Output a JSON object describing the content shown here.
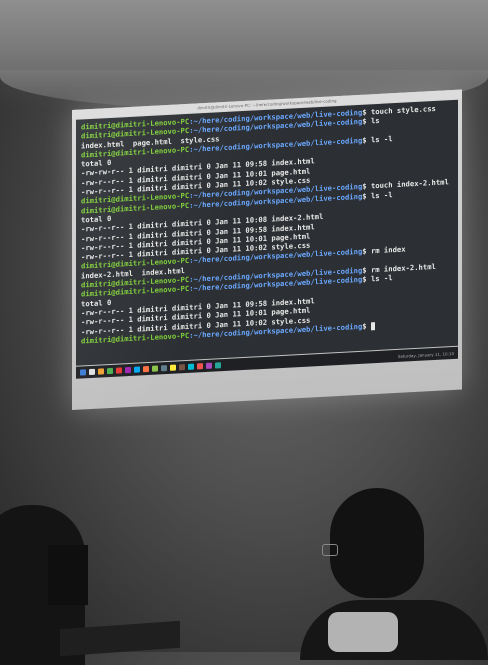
{
  "window": {
    "title": "dimitri@dimitri-Lenovo-PC: ~/here/coding/workspace/web/live-coding"
  },
  "prompt": {
    "user": "dimitri@dimitri-Lenovo-PC",
    "path": ":~/here/coding/workspace/web/live-coding",
    "symbol": "$ "
  },
  "lines": [
    {
      "type": "cmd",
      "cmd": "touch style.css"
    },
    {
      "type": "cmd",
      "cmd": "ls"
    },
    {
      "type": "out",
      "text": "index.html  page.html  style.css"
    },
    {
      "type": "cmd",
      "cmd": "ls -l"
    },
    {
      "type": "out",
      "text": "total 0"
    },
    {
      "type": "out",
      "text": "-rw-rw-r-- 1 dimitri dimitri 0 Jan 11 09:58 index.html"
    },
    {
      "type": "out",
      "text": "-rw-r--r-- 1 dimitri dimitri 0 Jan 11 10:01 page.html"
    },
    {
      "type": "out",
      "text": "-rw-r--r-- 1 dimitri dimitri 0 Jan 11 10:02 style.css"
    },
    {
      "type": "cmd",
      "cmd": "touch index-2.html"
    },
    {
      "type": "cmd",
      "cmd": "ls -l"
    },
    {
      "type": "out",
      "text": "total 0"
    },
    {
      "type": "out",
      "text": "-rw-r--r-- 1 dimitri dimitri 0 Jan 11 10:08 index-2.html"
    },
    {
      "type": "out",
      "text": "-rw-r--r-- 1 dimitri dimitri 0 Jan 11 09:58 index.html"
    },
    {
      "type": "out",
      "text": "-rw-r--r-- 1 dimitri dimitri 0 Jan 11 10:01 page.html"
    },
    {
      "type": "out",
      "text": "-rw-r--r-- 1 dimitri dimitri 0 Jan 11 10:02 style.css"
    },
    {
      "type": "cmd",
      "cmd": "rm index"
    },
    {
      "type": "out",
      "text": "index-2.html  index.html"
    },
    {
      "type": "cmd",
      "cmd": "rm index-2.html"
    },
    {
      "type": "cmd",
      "cmd": "ls -l"
    },
    {
      "type": "out",
      "text": "total 0"
    },
    {
      "type": "out",
      "text": "-rw-r--r-- 1 dimitri dimitri 0 Jan 11 09:58 index.html"
    },
    {
      "type": "out",
      "text": "-rw-r--r-- 1 dimitri dimitri 0 Jan 11 10:01 page.html"
    },
    {
      "type": "out",
      "text": "-rw-r--r-- 1 dimitri dimitri 0 Jan 11 10:02 style.css"
    },
    {
      "type": "cmd",
      "cmd": "",
      "cursor": true
    }
  ],
  "taskbar": {
    "icons": [
      "#3a7bd5",
      "#e0e0e0",
      "#f0a030",
      "#4caf50",
      "#e53935",
      "#9c27b0",
      "#03a9f4",
      "#ff7043",
      "#8bc34a",
      "#607d8b",
      "#ffeb3b",
      "#795548",
      "#00bcd4",
      "#ef5350",
      "#ab47bc",
      "#26a69a"
    ],
    "tray": "Saturday, January 11, 10:10"
  },
  "colors": {
    "user": "#7fd03a",
    "path": "#6aa8ff",
    "terminal_bg": "#2c2f33",
    "text": "#e8e8e8"
  }
}
